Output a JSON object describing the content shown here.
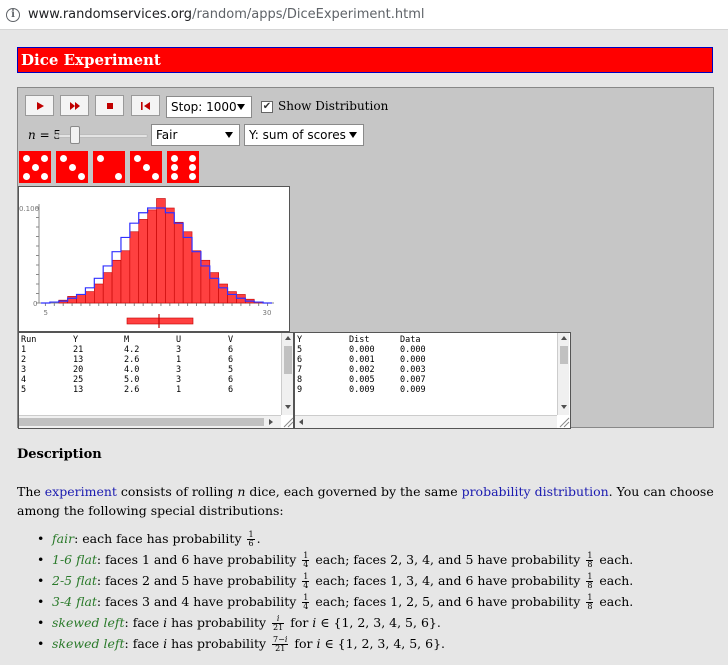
{
  "browser": {
    "url_host": "www.randomservices.org",
    "url_path": "/random/apps/DiceExperiment.html"
  },
  "title": "Dice Experiment",
  "controls": {
    "stop_value": "Stop: 1000",
    "show_distribution_label": "Show Distribution",
    "show_distribution_checked": true,
    "n_label": "n",
    "n_value": "= 5",
    "n_slider_fraction": 0.15,
    "distribution_value": "Fair",
    "variable_value": "Y: sum of scores"
  },
  "dice": [
    5,
    3,
    2,
    3,
    6
  ],
  "colors": {
    "accent": "#ff0000",
    "link": "#1a1ab0",
    "dist_name": "#2a7a2a",
    "dist_line": "#3030ff"
  },
  "chart_data": {
    "type": "bar",
    "y_tick_label": "0.100",
    "y_zero_label": "0",
    "x_tick_labels": [
      "5",
      "30"
    ],
    "x": [
      5,
      6,
      7,
      8,
      9,
      10,
      11,
      12,
      13,
      14,
      15,
      16,
      17,
      18,
      19,
      20,
      21,
      22,
      23,
      24,
      25,
      26,
      27,
      28,
      29,
      30
    ],
    "empirical": [
      0.0,
      0.0,
      0.003,
      0.007,
      0.009,
      0.012,
      0.02,
      0.032,
      0.045,
      0.055,
      0.075,
      0.088,
      0.098,
      0.11,
      0.1,
      0.085,
      0.075,
      0.055,
      0.045,
      0.032,
      0.02,
      0.012,
      0.009,
      0.004,
      0.001,
      0.0
    ],
    "distribution": [
      0.0,
      0.001,
      0.002,
      0.005,
      0.009,
      0.016,
      0.026,
      0.039,
      0.054,
      0.069,
      0.084,
      0.095,
      0.1,
      0.1,
      0.095,
      0.084,
      0.069,
      0.054,
      0.039,
      0.026,
      0.016,
      0.009,
      0.005,
      0.002,
      0.001,
      0.0
    ]
  },
  "run_table": {
    "headers": [
      "Run",
      "Y",
      "M",
      "U",
      "V"
    ],
    "rows": [
      [
        "1",
        "21",
        "4.2",
        "3",
        "6"
      ],
      [
        "2",
        "13",
        "2.6",
        "1",
        "6"
      ],
      [
        "3",
        "20",
        "4.0",
        "3",
        "5"
      ],
      [
        "4",
        "25",
        "5.0",
        "3",
        "6"
      ],
      [
        "5",
        "13",
        "2.6",
        "1",
        "6"
      ]
    ]
  },
  "dist_table": {
    "headers": [
      "Y",
      "Dist",
      "Data"
    ],
    "rows": [
      [
        "5",
        "0.000",
        "0.000"
      ],
      [
        "6",
        "0.001",
        "0.000"
      ],
      [
        "7",
        "0.002",
        "0.003"
      ],
      [
        "8",
        "0.005",
        "0.007"
      ],
      [
        "9",
        "0.009",
        "0.009"
      ]
    ]
  },
  "description": {
    "heading": "Description",
    "p1_a": "The ",
    "p1_link1": "experiment",
    "p1_b": " consists of rolling ",
    "p1_n": "n",
    "p1_c": " dice, each governed by the same ",
    "p1_link2": "probability distribution",
    "p1_d": ". You can choose among the following special distributions:",
    "items": [
      {
        "name": "fair",
        "text": ": each face has probability "
      },
      {
        "name": "1-6 flat",
        "text": ": faces 1 and 6 have probability ",
        "mid": " each; faces 2, 3, 4, and 5 have probability ",
        "end": " each."
      },
      {
        "name": "2-5 flat",
        "text": ": faces 2 and 5 have probability ",
        "mid": " each; faces 1, 3, 4, and 6 have probability ",
        "end": " each."
      },
      {
        "name": "3-4 flat",
        "text": ": faces 3 and 4 have probability ",
        "mid": " each; faces 1, 2, 5, and 6 have probability ",
        "end": " each."
      },
      {
        "name": "skewed left",
        "text": ": face ",
        "mid": " has probability ",
        "end": " for ",
        "set": "{1, 2, 3, 4, 5, 6}."
      },
      {
        "name": "skewed left",
        "text": ": face ",
        "mid": " has probability ",
        "end": " for ",
        "set": "{1, 2, 3, 4, 5, 6}."
      }
    ]
  }
}
